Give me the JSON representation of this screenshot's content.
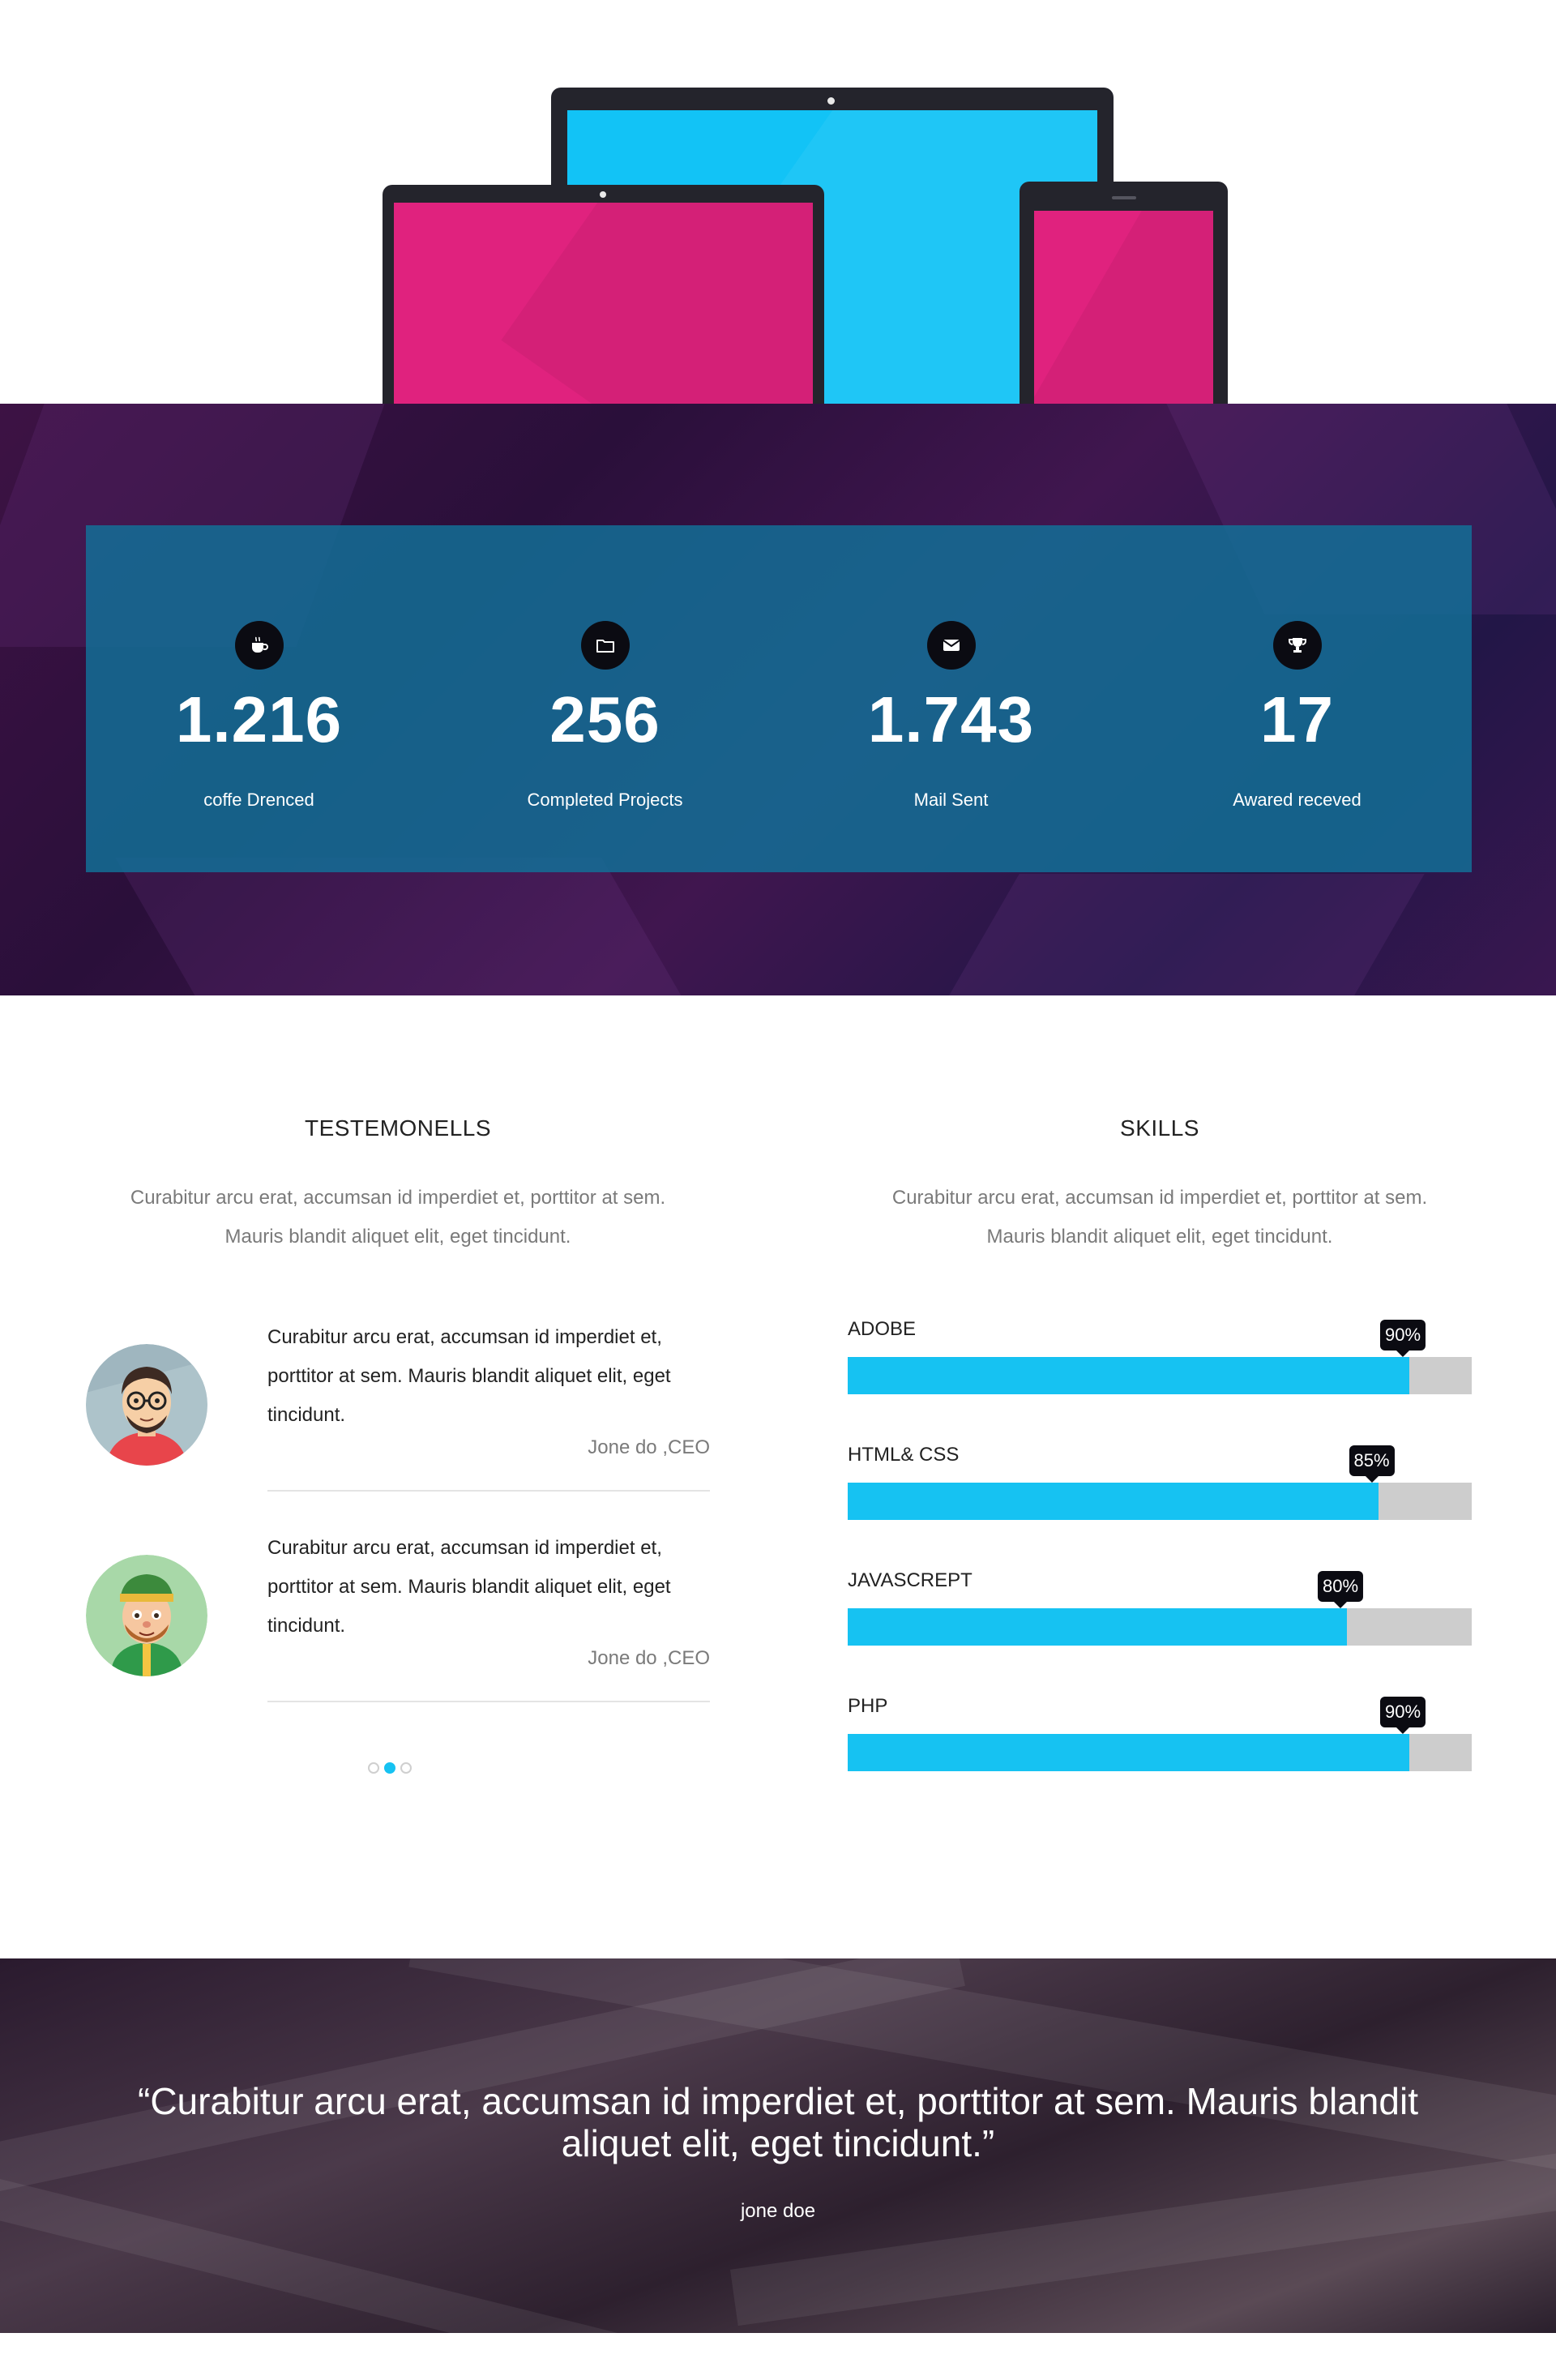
{
  "stats": [
    {
      "icon": "coffee-icon",
      "number": "1.216",
      "label": "coffe Drenced"
    },
    {
      "icon": "folder-icon",
      "number": "256",
      "label": "Completed Projects"
    },
    {
      "icon": "mail-icon",
      "number": "1.743",
      "label": "Mail Sent"
    },
    {
      "icon": "trophy-icon",
      "number": "17",
      "label": "Awared receved"
    }
  ],
  "testimonials_section": {
    "title": "TESTEMONELLS",
    "desc_line1": "Curabitur arcu erat, accumsan id imperdiet et, porttitor at sem.",
    "desc_line2": "Mauris blandit aliquet elit, eget tincidunt.",
    "items": [
      {
        "text": "Curabitur arcu erat, accumsan id imperdiet et, porttitor at sem. Mauris blandit aliquet elit, eget tincidunt.",
        "author": "Jone do ,CEO"
      },
      {
        "text": "Curabitur arcu erat, accumsan id imperdiet et, porttitor at sem. Mauris blandit aliquet elit, eget tincidunt.",
        "author": "Jone do ,CEO"
      }
    ],
    "carousel": {
      "count": 3,
      "active_index": 1
    }
  },
  "skills_section": {
    "title": "SKILLS",
    "desc_line1": "Curabitur arcu erat, accumsan id imperdiet et, porttitor at sem.",
    "desc_line2": "Mauris blandit aliquet elit, eget tincidunt.",
    "items": [
      {
        "name": "ADOBE",
        "percent_label": "90%",
        "value": 90
      },
      {
        "name": "HTML& CSS",
        "percent_label": "85%",
        "value": 85
      },
      {
        "name": "JAVASCREPT",
        "percent_label": "80%",
        "value": 80
      },
      {
        "name": "PHP",
        "percent_label": "90%",
        "value": 90
      }
    ]
  },
  "quote_section": {
    "quote": "“Curabitur arcu erat, accumsan id imperdiet et, porttitor at sem. Mauris blandit aliquet elit, eget tincidunt.”",
    "author": "jone doe"
  },
  "colors": {
    "accent": "#16c2f2",
    "magenta": "#e0227e",
    "stats_panel": "#136e96",
    "track": "#cdcdcd"
  }
}
